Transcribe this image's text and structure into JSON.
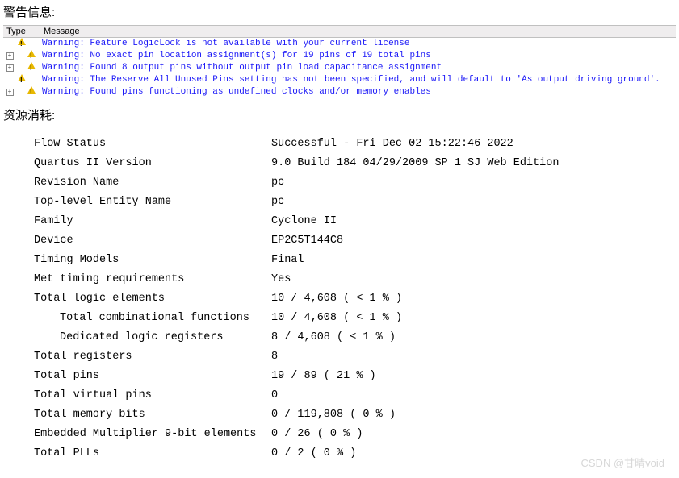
{
  "titles": {
    "warnings": "警告信息:",
    "resources": "资源消耗:"
  },
  "msg_headers": {
    "type": "Type",
    "message": "Message"
  },
  "messages": [
    {
      "expand": false,
      "indent": false,
      "text": "Warning: Feature LogicLock is not available with your current license"
    },
    {
      "expand": true,
      "indent": true,
      "text": "Warning: No exact pin location assignment(s) for 19 pins of 19 total pins"
    },
    {
      "expand": true,
      "indent": true,
      "text": "Warning: Found 8 output pins without output pin load capacitance assignment"
    },
    {
      "expand": false,
      "indent": false,
      "text": "Warning: The Reserve All Unused Pins setting has not been specified, and will default to 'As output driving ground'."
    },
    {
      "expand": true,
      "indent": true,
      "text": "Warning: Found pins functioning as undefined clocks and/or memory enables"
    }
  ],
  "summary": [
    {
      "label": "Flow Status",
      "value": "Successful - Fri Dec 02 15:22:46 2022",
      "indent": false
    },
    {
      "label": "Quartus II Version",
      "value": "9.0 Build 184 04/29/2009 SP 1 SJ Web Edition",
      "indent": false
    },
    {
      "label": "Revision Name",
      "value": "pc",
      "indent": false
    },
    {
      "label": "Top-level Entity Name",
      "value": "pc",
      "indent": false
    },
    {
      "label": "Family",
      "value": "Cyclone II",
      "indent": false
    },
    {
      "label": "Device",
      "value": "EP2C5T144C8",
      "indent": false
    },
    {
      "label": "Timing Models",
      "value": "Final",
      "indent": false
    },
    {
      "label": "Met timing requirements",
      "value": "Yes",
      "indent": false
    },
    {
      "label": "Total logic elements",
      "value": "10 / 4,608 ( < 1 % )",
      "indent": false
    },
    {
      "label": "Total combinational functions",
      "value": "10 / 4,608 ( < 1 % )",
      "indent": true
    },
    {
      "label": "Dedicated logic registers",
      "value": "8 / 4,608 ( < 1 % )",
      "indent": true
    },
    {
      "label": "Total registers",
      "value": "8",
      "indent": false
    },
    {
      "label": "Total pins",
      "value": "19 / 89 ( 21 % )",
      "indent": false
    },
    {
      "label": "Total virtual pins",
      "value": "0",
      "indent": false
    },
    {
      "label": "Total memory bits",
      "value": "0 / 119,808 ( 0 % )",
      "indent": false
    },
    {
      "label": "Embedded Multiplier 9-bit elements",
      "value": "0 / 26 ( 0 % )",
      "indent": false
    },
    {
      "label": "Total PLLs",
      "value": "0 / 2 ( 0 % )",
      "indent": false
    }
  ],
  "watermark": "CSDN @甘晴void"
}
